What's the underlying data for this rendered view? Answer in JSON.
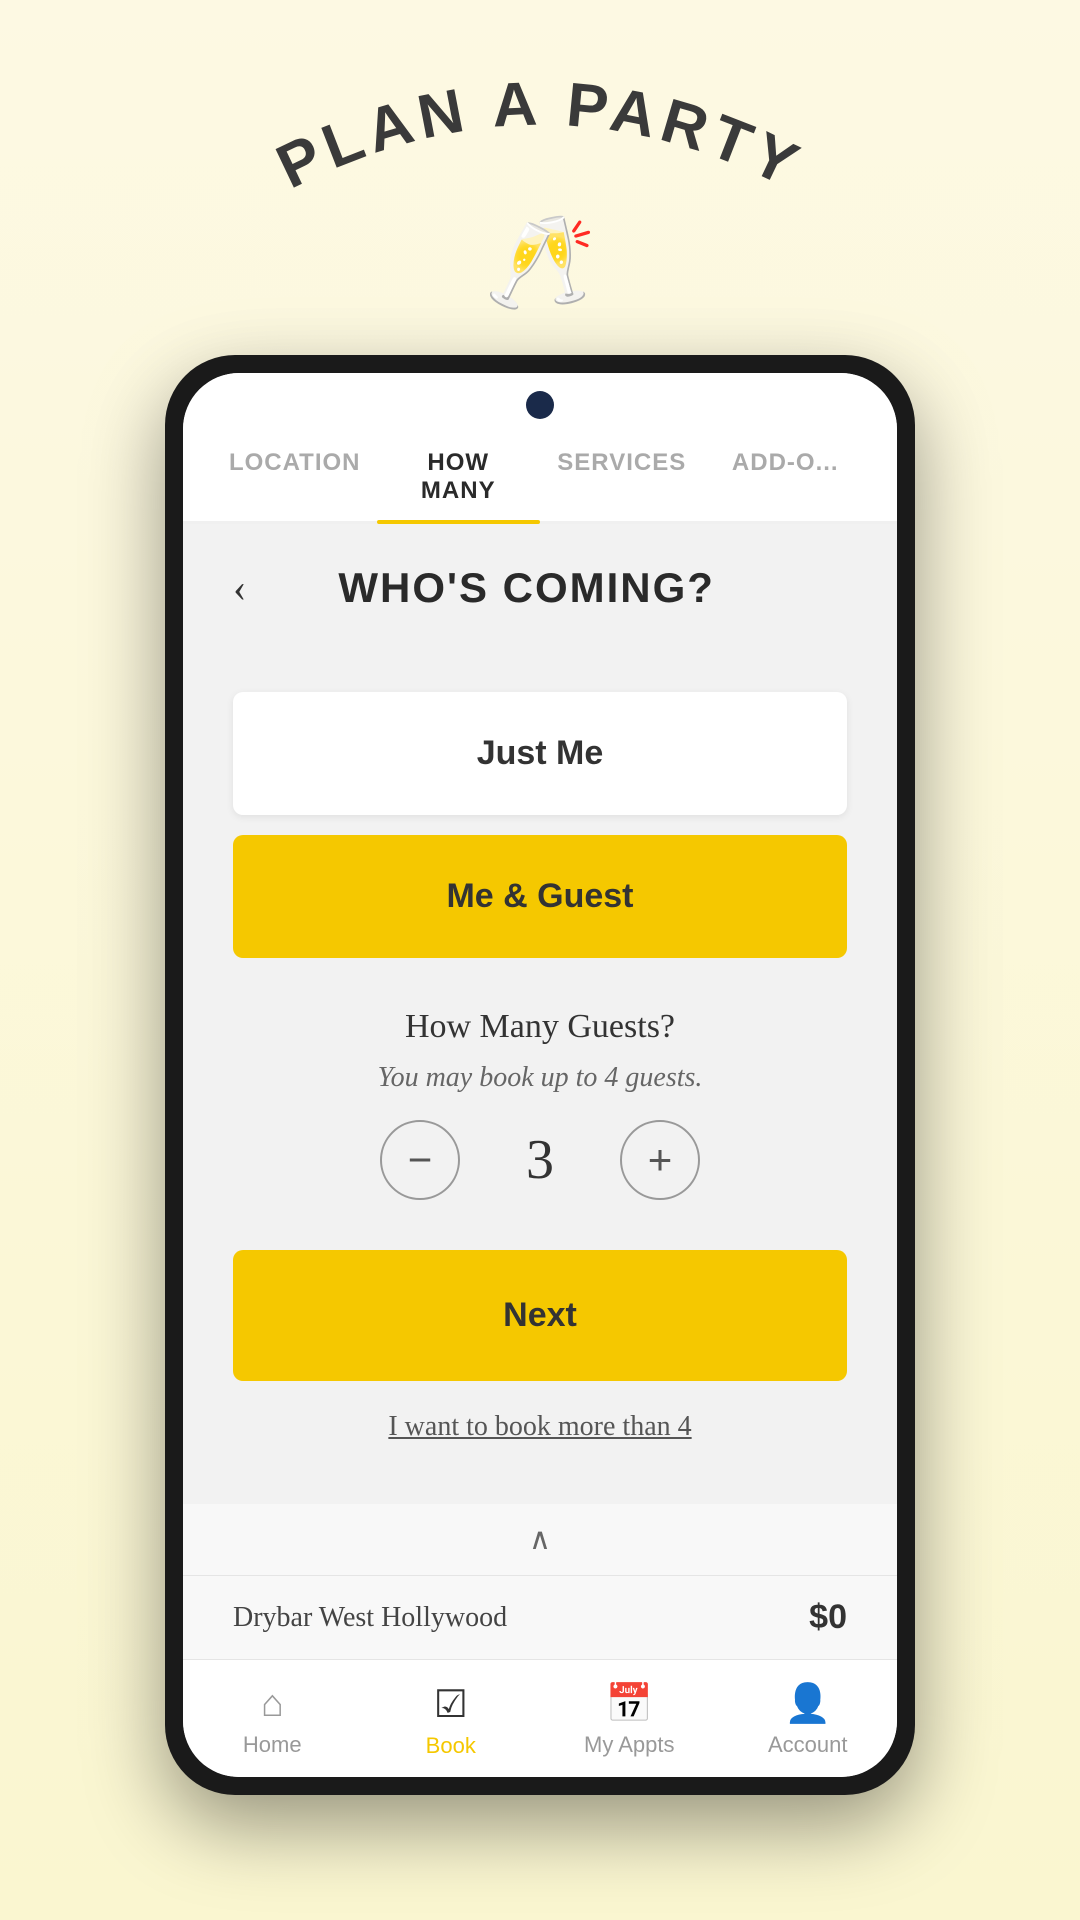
{
  "header": {
    "title": "PLAN A PARTY",
    "icon": "🥂"
  },
  "tabs": [
    {
      "id": "location",
      "label": "LOCATION",
      "active": false
    },
    {
      "id": "how-many",
      "label": "HOW MANY",
      "active": true
    },
    {
      "id": "services",
      "label": "SERVICES",
      "active": false
    },
    {
      "id": "add-ons",
      "label": "ADD-O...",
      "active": false
    }
  ],
  "page": {
    "title": "WHO'S COMING?",
    "back_label": "‹"
  },
  "options": [
    {
      "id": "just-me",
      "label": "Just Me",
      "style": "white"
    },
    {
      "id": "me-and-guest",
      "label": "Me & Guest",
      "style": "yellow"
    }
  ],
  "guests_section": {
    "title": "How Many Guests?",
    "subtitle": "You may book up to 4 guests.",
    "count": "3",
    "decrement_label": "−",
    "increment_label": "+"
  },
  "next_button": {
    "label": "Next"
  },
  "book_more_link": {
    "label": "I want to book more than 4"
  },
  "bottom_bar": {
    "location": "Drybar West Hollywood",
    "price": "$0"
  },
  "nav": {
    "items": [
      {
        "id": "home",
        "label": "Home",
        "icon": "⌂",
        "active": false
      },
      {
        "id": "book",
        "label": "Book",
        "icon": "☑",
        "active": true
      },
      {
        "id": "my-appts",
        "label": "My Appts",
        "icon": "📅",
        "active": false
      },
      {
        "id": "account",
        "label": "Account",
        "icon": "👤",
        "active": false
      }
    ]
  }
}
